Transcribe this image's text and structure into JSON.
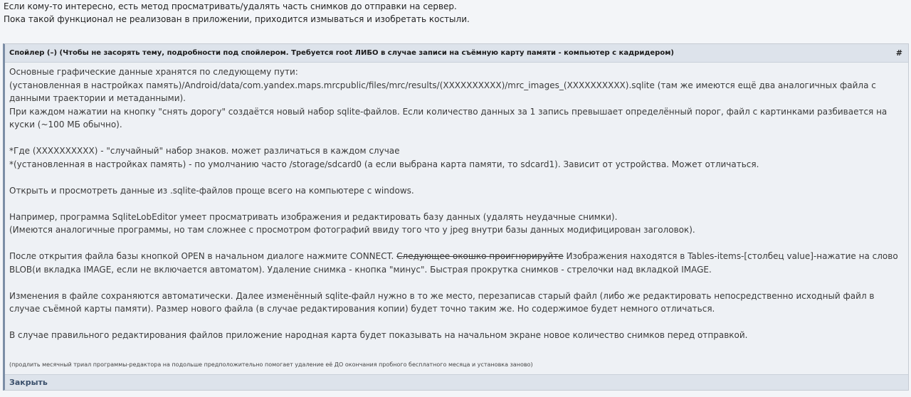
{
  "intro": {
    "line1": "Если кому-то интересно, есть метод просматривать/удалять часть снимков до отправки на сервер.",
    "line2": "Пока такой функционал не реализован в приложении, приходится измываться и изобретать костыли."
  },
  "spoiler": {
    "title": "Спойлер (–) (Чтобы не засорять тему, подробности под спойлером. Требуется root ЛИБО в случае записи на съёмную карту памяти - компьютер с кадридером)",
    "anchor": "#",
    "close_label": "Закрыть",
    "body": {
      "p1": "Основные графические данные хранятся по следующему пути:",
      "p2": "(установленная в настройках память)/Android/data/com.yandex.maps.mrcpublic/files/mrc/results/(XXXXXXXXXX)/mrc_images_(XXXXXXXXXX).sqlite (там же имеются ещё два аналогичных файла с данными траектории и метаданными).",
      "p3": "При каждом нажатии на кнопку \"снять дорогу\" создаётся новый набор sqlite-файлов. Если количество данных за 1 запись превышает определённый порог, файл с картинками разбивается на куски (~100 МБ обычно).",
      "p4": "*Где (XXXXXXXXXX) - \"случайный\" набор знаков. может различаться в каждом случае",
      "p5": "*(установленная в настройках память) - по умолчанию часто /storage/sdcard0 (а если выбрана карта памяти, то sdcard1). Зависит от устройства. Может отличаться.",
      "p6": "Открыть и просмотреть данные из .sqlite-файлов проще всего на компьютере с windows.",
      "p7": "Например, программа SqliteLobEditor умеет просматривать изображения и редактировать базу данных (удалять неудачные снимки).",
      "p8": "(Имеются аналогичные программы, но там сложнее с просмотром фотографий ввиду того что у jpeg внутри базы данных модифицирован заголовок).",
      "p9_before": "После открытия файла базы кнопкой OPEN в начальном диалоге нажмите CONNECT. ",
      "p9_strike": "Следующее окошко проигнорируйте",
      "p9_after": " Изображения находятся в Tables-items-[столбец value]-нажатие на слово BLOB(и вкладка IMAGE, если не включается автоматом). Удаление снимка - кнопка \"минус\". Быстрая прокрутка снимков - стрелочки над вкладкой IMAGE.",
      "p10": "Изменения в файле сохраняются автоматически. Далее изменённый sqlite-файл нужно в то же место, перезаписав старый файл (либо же редактировать непосредственно исходный файл в случае съёмной карты памяти). Размер нового файла (в случае редактирования копии) будет точно таким же. Но содержимое будет немного отличаться.",
      "p11": "В случае правильного редактирования файлов приложение народная карта будет показывать на начальном экране новое количество снимков перед отправкой."
    },
    "note": "(продлить месячный триал программы-редактора на подольше предположительно помогает удаление её ДО окончания пробного бесплатного месяца и установка заново)"
  }
}
